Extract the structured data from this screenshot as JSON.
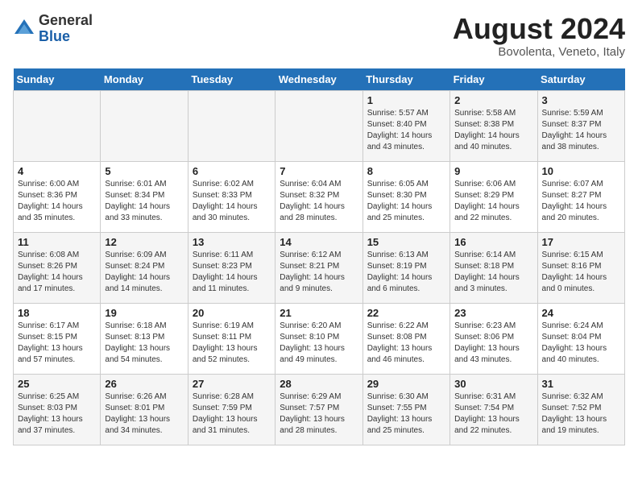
{
  "header": {
    "logo_general": "General",
    "logo_blue": "Blue",
    "month_year": "August 2024",
    "location": "Bovolenta, Veneto, Italy"
  },
  "days_of_week": [
    "Sunday",
    "Monday",
    "Tuesday",
    "Wednesday",
    "Thursday",
    "Friday",
    "Saturday"
  ],
  "weeks": [
    [
      {
        "day": "",
        "info": ""
      },
      {
        "day": "",
        "info": ""
      },
      {
        "day": "",
        "info": ""
      },
      {
        "day": "",
        "info": ""
      },
      {
        "day": "1",
        "info": "Sunrise: 5:57 AM\nSunset: 8:40 PM\nDaylight: 14 hours\nand 43 minutes."
      },
      {
        "day": "2",
        "info": "Sunrise: 5:58 AM\nSunset: 8:38 PM\nDaylight: 14 hours\nand 40 minutes."
      },
      {
        "day": "3",
        "info": "Sunrise: 5:59 AM\nSunset: 8:37 PM\nDaylight: 14 hours\nand 38 minutes."
      }
    ],
    [
      {
        "day": "4",
        "info": "Sunrise: 6:00 AM\nSunset: 8:36 PM\nDaylight: 14 hours\nand 35 minutes."
      },
      {
        "day": "5",
        "info": "Sunrise: 6:01 AM\nSunset: 8:34 PM\nDaylight: 14 hours\nand 33 minutes."
      },
      {
        "day": "6",
        "info": "Sunrise: 6:02 AM\nSunset: 8:33 PM\nDaylight: 14 hours\nand 30 minutes."
      },
      {
        "day": "7",
        "info": "Sunrise: 6:04 AM\nSunset: 8:32 PM\nDaylight: 14 hours\nand 28 minutes."
      },
      {
        "day": "8",
        "info": "Sunrise: 6:05 AM\nSunset: 8:30 PM\nDaylight: 14 hours\nand 25 minutes."
      },
      {
        "day": "9",
        "info": "Sunrise: 6:06 AM\nSunset: 8:29 PM\nDaylight: 14 hours\nand 22 minutes."
      },
      {
        "day": "10",
        "info": "Sunrise: 6:07 AM\nSunset: 8:27 PM\nDaylight: 14 hours\nand 20 minutes."
      }
    ],
    [
      {
        "day": "11",
        "info": "Sunrise: 6:08 AM\nSunset: 8:26 PM\nDaylight: 14 hours\nand 17 minutes."
      },
      {
        "day": "12",
        "info": "Sunrise: 6:09 AM\nSunset: 8:24 PM\nDaylight: 14 hours\nand 14 minutes."
      },
      {
        "day": "13",
        "info": "Sunrise: 6:11 AM\nSunset: 8:23 PM\nDaylight: 14 hours\nand 11 minutes."
      },
      {
        "day": "14",
        "info": "Sunrise: 6:12 AM\nSunset: 8:21 PM\nDaylight: 14 hours\nand 9 minutes."
      },
      {
        "day": "15",
        "info": "Sunrise: 6:13 AM\nSunset: 8:19 PM\nDaylight: 14 hours\nand 6 minutes."
      },
      {
        "day": "16",
        "info": "Sunrise: 6:14 AM\nSunset: 8:18 PM\nDaylight: 14 hours\nand 3 minutes."
      },
      {
        "day": "17",
        "info": "Sunrise: 6:15 AM\nSunset: 8:16 PM\nDaylight: 14 hours\nand 0 minutes."
      }
    ],
    [
      {
        "day": "18",
        "info": "Sunrise: 6:17 AM\nSunset: 8:15 PM\nDaylight: 13 hours\nand 57 minutes."
      },
      {
        "day": "19",
        "info": "Sunrise: 6:18 AM\nSunset: 8:13 PM\nDaylight: 13 hours\nand 54 minutes."
      },
      {
        "day": "20",
        "info": "Sunrise: 6:19 AM\nSunset: 8:11 PM\nDaylight: 13 hours\nand 52 minutes."
      },
      {
        "day": "21",
        "info": "Sunrise: 6:20 AM\nSunset: 8:10 PM\nDaylight: 13 hours\nand 49 minutes."
      },
      {
        "day": "22",
        "info": "Sunrise: 6:22 AM\nSunset: 8:08 PM\nDaylight: 13 hours\nand 46 minutes."
      },
      {
        "day": "23",
        "info": "Sunrise: 6:23 AM\nSunset: 8:06 PM\nDaylight: 13 hours\nand 43 minutes."
      },
      {
        "day": "24",
        "info": "Sunrise: 6:24 AM\nSunset: 8:04 PM\nDaylight: 13 hours\nand 40 minutes."
      }
    ],
    [
      {
        "day": "25",
        "info": "Sunrise: 6:25 AM\nSunset: 8:03 PM\nDaylight: 13 hours\nand 37 minutes."
      },
      {
        "day": "26",
        "info": "Sunrise: 6:26 AM\nSunset: 8:01 PM\nDaylight: 13 hours\nand 34 minutes."
      },
      {
        "day": "27",
        "info": "Sunrise: 6:28 AM\nSunset: 7:59 PM\nDaylight: 13 hours\nand 31 minutes."
      },
      {
        "day": "28",
        "info": "Sunrise: 6:29 AM\nSunset: 7:57 PM\nDaylight: 13 hours\nand 28 minutes."
      },
      {
        "day": "29",
        "info": "Sunrise: 6:30 AM\nSunset: 7:55 PM\nDaylight: 13 hours\nand 25 minutes."
      },
      {
        "day": "30",
        "info": "Sunrise: 6:31 AM\nSunset: 7:54 PM\nDaylight: 13 hours\nand 22 minutes."
      },
      {
        "day": "31",
        "info": "Sunrise: 6:32 AM\nSunset: 7:52 PM\nDaylight: 13 hours\nand 19 minutes."
      }
    ]
  ]
}
